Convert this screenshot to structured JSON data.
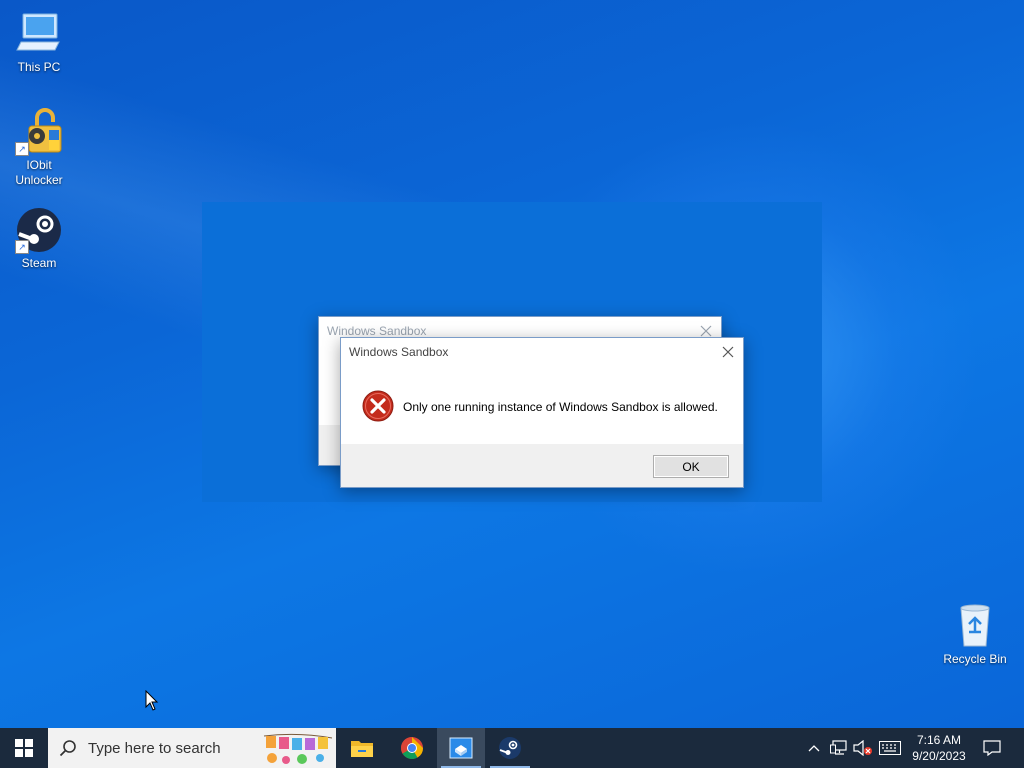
{
  "desktop": {
    "icons": [
      {
        "label": "This PC"
      },
      {
        "label": "IObit\nUnlocker"
      },
      {
        "label": "Steam"
      },
      {
        "label": "Recycle Bin"
      }
    ]
  },
  "back_dialog": {
    "title": "Windows Sandbox"
  },
  "dialog": {
    "title": "Windows Sandbox",
    "message": "Only one running instance of Windows Sandbox is allowed.",
    "ok_label": "OK",
    "error_icon": "error-circle-x-icon"
  },
  "taskbar": {
    "search_placeholder": "Type here to search",
    "apps": [
      {
        "icon": "file-explorer-icon"
      },
      {
        "icon": "chrome-icon"
      },
      {
        "icon": "windows-sandbox-icon",
        "active": true
      },
      {
        "icon": "steam-icon"
      }
    ],
    "clock": {
      "time": "7:16 AM",
      "date": "9/20/2023"
    }
  },
  "colors": {
    "taskbar": "#1b2a3d",
    "error_red": "#c42b1c",
    "desktop_blue": "#0b66d6"
  }
}
